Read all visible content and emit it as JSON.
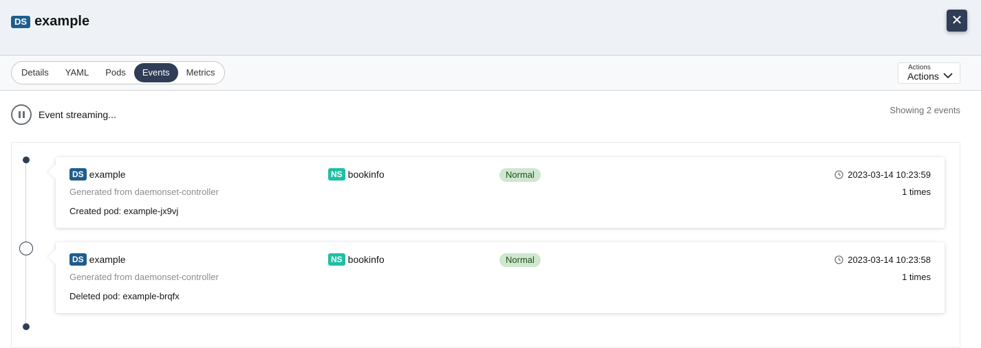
{
  "header": {
    "kind_badge": "DS",
    "title": "example",
    "close_icon": "close-icon"
  },
  "tabs": [
    {
      "label": "Details"
    },
    {
      "label": "YAML"
    },
    {
      "label": "Pods"
    },
    {
      "label": "Events",
      "active": true
    },
    {
      "label": "Metrics"
    }
  ],
  "actions": {
    "label": "Actions",
    "value": "Actions",
    "icon": "chevron-down-icon"
  },
  "stream": {
    "icon": "pause-icon",
    "text": "Event streaming...",
    "count_text": "Showing 2 events"
  },
  "events": [
    {
      "kind_badge": "DS",
      "name": "example",
      "source": "Generated from daemonset-controller",
      "message": "Created pod: example-jx9vj",
      "ns_badge": "NS",
      "namespace": "bookinfo",
      "type": "Normal",
      "timestamp": "2023-03-14 10:23:59",
      "count": "1 times"
    },
    {
      "kind_badge": "DS",
      "name": "example",
      "source": "Generated from daemonset-controller",
      "message": "Deleted pod: example-brqfx",
      "ns_badge": "NS",
      "namespace": "bookinfo",
      "type": "Normal",
      "timestamp": "2023-03-14 10:23:58",
      "count": "1 times"
    }
  ],
  "colors": {
    "primary_dark": "#2f3d56",
    "ds_badge": "#1f5d8c",
    "ns_badge": "#1fbfa4",
    "normal_label_bg": "#cfe6cf"
  }
}
